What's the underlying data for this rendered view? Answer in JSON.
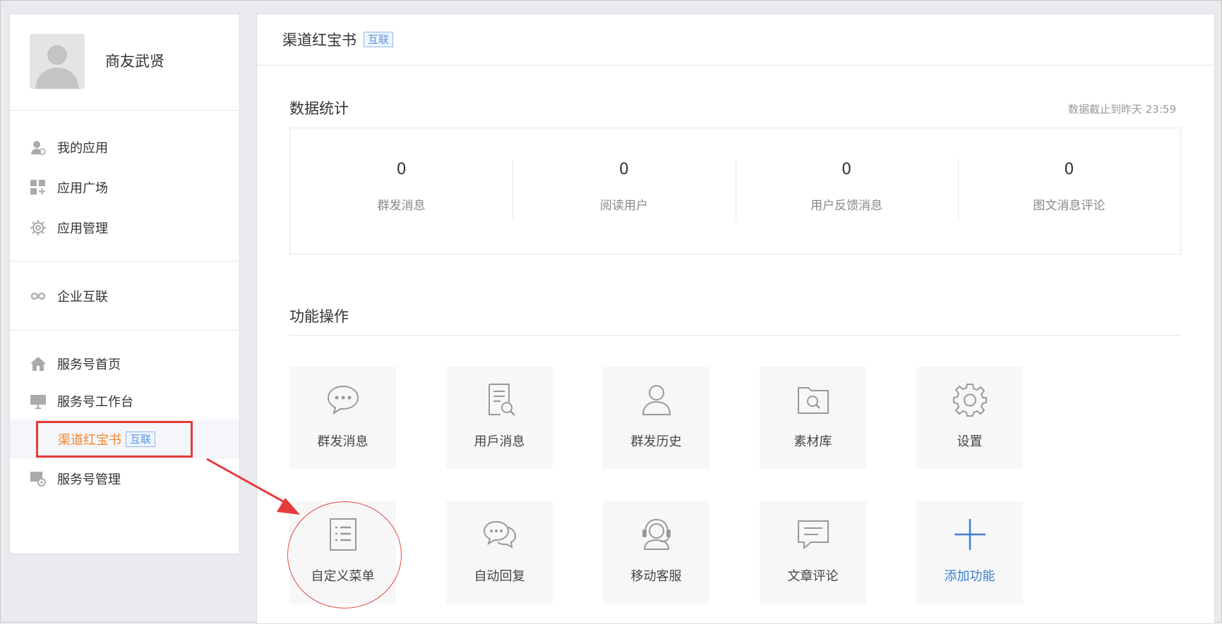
{
  "profile": {
    "name": "商友武贤"
  },
  "sidebar": {
    "group1": [
      {
        "label": "我的应用",
        "icon": "user-app-icon"
      },
      {
        "label": "应用广场",
        "icon": "grid-plus-icon"
      },
      {
        "label": "应用管理",
        "icon": "gear-icon"
      }
    ],
    "group2": [
      {
        "label": "企业互联",
        "icon": "link-icon"
      }
    ],
    "group3": [
      {
        "label": "服务号首页",
        "icon": "home-icon"
      },
      {
        "label": "服务号工作台",
        "icon": "monitor-icon"
      }
    ],
    "active_sub": {
      "label": "渠道红宝书",
      "tag": "互联"
    },
    "group3_after": {
      "label": "服务号管理",
      "icon": "manage-gear-icon"
    }
  },
  "main": {
    "title": "渠道红宝书",
    "title_tag": "互联",
    "stats_title": "数据统计",
    "stats_note": "数据截止到昨天 23:59",
    "stats": [
      {
        "value": "0",
        "label": "群发消息"
      },
      {
        "value": "0",
        "label": "阅读用户"
      },
      {
        "value": "0",
        "label": "用户反馈消息"
      },
      {
        "value": "0",
        "label": "图文消息评论"
      }
    ],
    "functions_title": "功能操作",
    "functions": [
      {
        "label": "群发消息",
        "icon": "chat-bubble-icon"
      },
      {
        "label": "用戶消息",
        "icon": "document-search-icon"
      },
      {
        "label": "群发历史",
        "icon": "person-icon"
      },
      {
        "label": "素材库",
        "icon": "folder-search-icon"
      },
      {
        "label": "设置",
        "icon": "settings-gear-icon"
      },
      {
        "label": "自定义菜单",
        "icon": "menu-list-icon"
      },
      {
        "label": "自动回复",
        "icon": "chat-double-icon"
      },
      {
        "label": "移动客服",
        "icon": "headset-icon"
      },
      {
        "label": "文章评论",
        "icon": "comment-box-icon"
      },
      {
        "label": "添加功能",
        "icon": "plus-icon"
      }
    ]
  },
  "colors": {
    "accent_orange": "#f0862f",
    "highlight_red": "#e53a3a",
    "link_blue": "#3d7fd6"
  }
}
